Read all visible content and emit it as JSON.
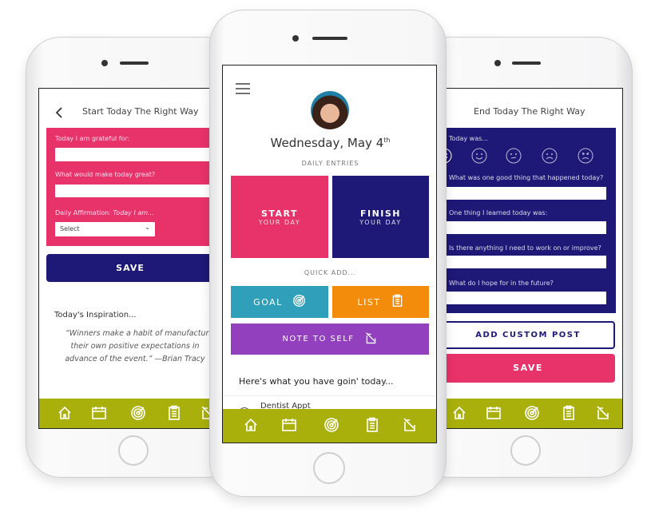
{
  "colors": {
    "pink": "#e8336a",
    "navy": "#1e1877",
    "teal": "#2f9fba",
    "orange": "#f28c0a",
    "purple": "#9240be",
    "olive": "#a9b00c"
  },
  "tabbar_icons": [
    "home-icon",
    "calendar-icon",
    "target-icon",
    "clipboard-icon",
    "note-icon"
  ],
  "left": {
    "title": "Start Today The Right Way",
    "grateful_label": "Today I am grateful for:",
    "great_label": "What would make today great?",
    "affirmation_label": "Daily Affirmation:",
    "affirmation_prefix": "Today I am...",
    "select_value": "Select",
    "save": "SAVE",
    "inspiration_title": "Today's Inspiration...",
    "quote_lines": [
      "“Winners make a habit of manufacturing",
      "their own positive expectations in",
      "advance of the event.” —Brian Tracy"
    ]
  },
  "center": {
    "date": "Wednesday, May 4",
    "date_suffix": "th",
    "daily_entries": "DAILY ENTRIES",
    "start_title": "START",
    "start_sub": "YOUR DAY",
    "finish_title": "FINISH",
    "finish_sub": "YOUR DAY",
    "quick_add": "QUICK ADD...",
    "goal": "GOAL",
    "list": "LIST",
    "note": "NOTE TO SELF",
    "agenda_heading": "Here's what you have goin' today...",
    "agenda_items": [
      "Dentist Appt"
    ]
  },
  "right": {
    "title": "End Today The Right Way",
    "today_was": "Today was...",
    "moods": [
      "very-happy",
      "happy",
      "neutral",
      "sad",
      "angry"
    ],
    "questions": [
      "What was one good thing that happened today?",
      "One thing I learned today was:",
      "Is there anything I need to work on or improve?",
      "What do I hope for in the future?"
    ],
    "add_custom": "ADD CUSTOM POST",
    "save": "SAVE"
  }
}
